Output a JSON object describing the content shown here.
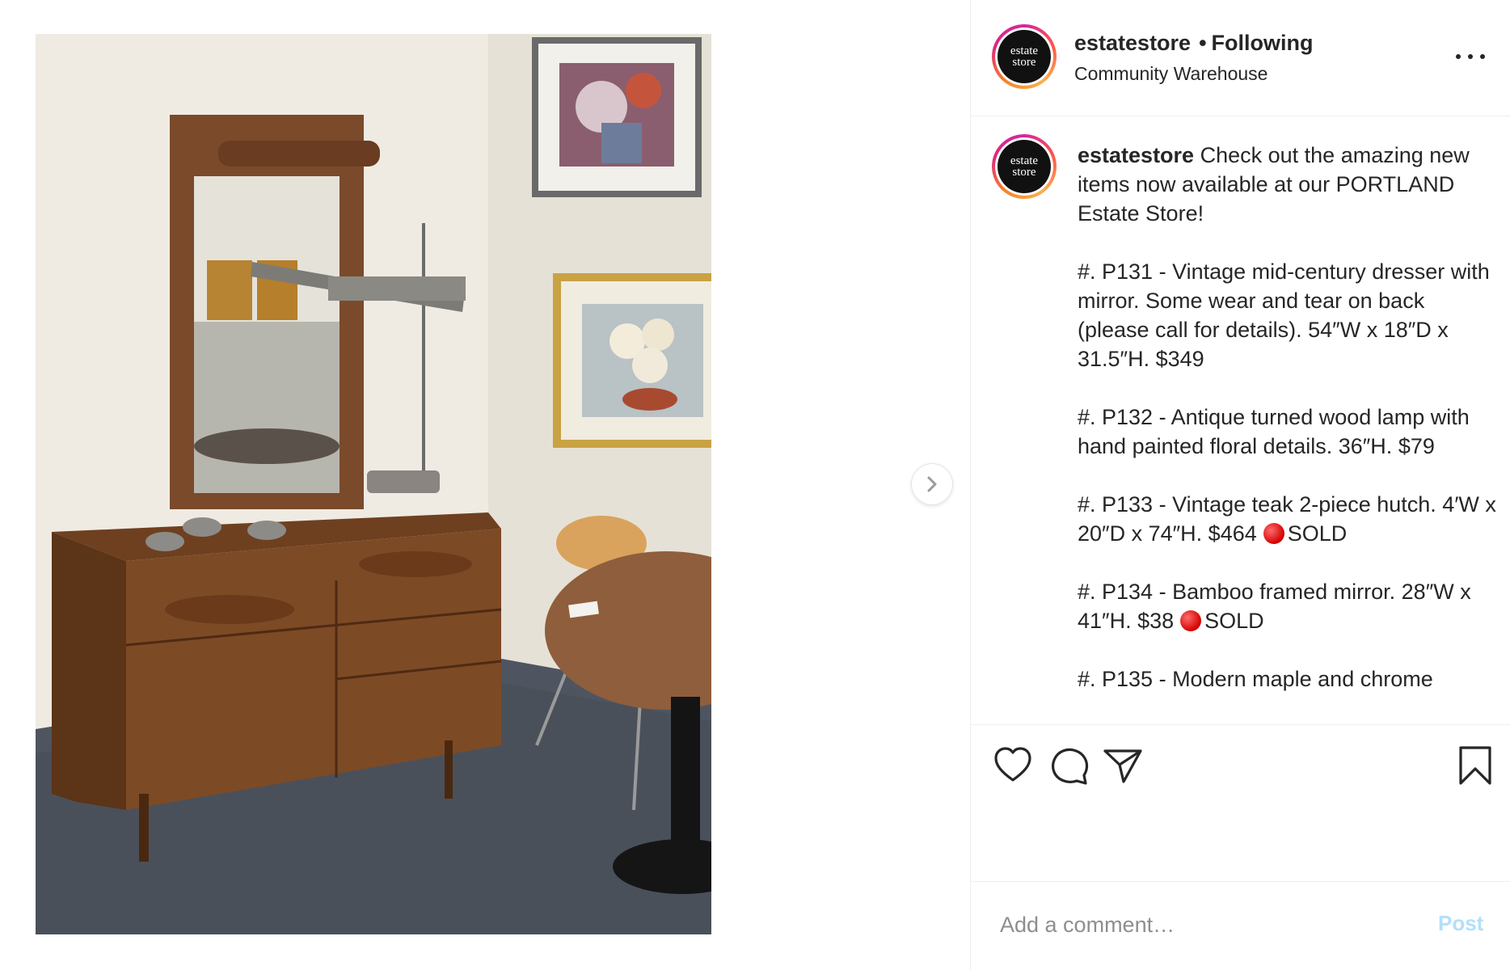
{
  "post": {
    "username": "estatestore",
    "dot": "•",
    "follow_status": "Following",
    "location": "Community Warehouse",
    "avatar_text_line1": "estate",
    "avatar_text_line2": "store"
  },
  "caption": {
    "username": "estatestore",
    "intro": "Check out the amazing new items now available at our PORTLAND Estate Store!",
    "items": [
      {
        "text": "#. P131 - Vintage mid-century dresser with mirror. Some wear and tear on back (please call for details). 54″W x 18″D x 31.5″H. $349",
        "sold_label": ""
      },
      {
        "text": "#. P132 - Antique turned wood lamp with hand painted floral details. 36″H. $79",
        "sold_label": ""
      },
      {
        "text": "#. P133 - Vintage teak 2-piece hutch. 4′W x 20″D x 74″H. $464",
        "sold_label": "SOLD"
      },
      {
        "text": "#. P134 - Bamboo framed mirror. 28″W x 41″H. $38",
        "sold_label": "SOLD"
      },
      {
        "text": "#. P135 - Modern maple and chrome",
        "sold_label": ""
      }
    ]
  },
  "actions": {
    "like_icon": "heart-icon",
    "comment_icon": "speech-bubble-icon",
    "share_icon": "paper-plane-icon",
    "save_icon": "bookmark-icon"
  },
  "comment": {
    "placeholder": "Add a comment…",
    "post_label": "Post"
  },
  "media": {
    "next_icon": "chevron-right-icon",
    "photo_subject": "dresser-with-mirror-photo"
  },
  "colors": {
    "text": "#262626",
    "muted": "#8e8e8e",
    "post_disabled": "#b2dffc",
    "sold_dot": "#d40000"
  }
}
